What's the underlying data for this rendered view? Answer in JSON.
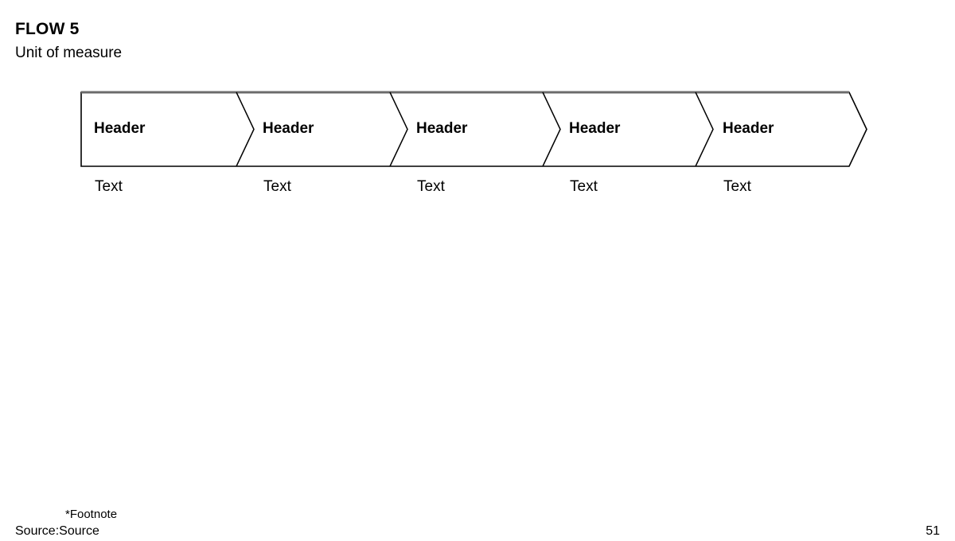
{
  "slide": {
    "title": "FLOW 5",
    "subtitle": "Unit of measure"
  },
  "flow": {
    "stages": [
      {
        "header": "Header",
        "text": "Text"
      },
      {
        "header": "Header",
        "text": "Text"
      },
      {
        "header": "Header",
        "text": "Text"
      },
      {
        "header": "Header",
        "text": "Text"
      },
      {
        "header": "Header",
        "text": "Text"
      }
    ]
  },
  "footer": {
    "footnote": "*Footnote",
    "source": "Source:Source",
    "page_number": "51"
  },
  "colors": {
    "top_border": "#6b6b6b",
    "outline": "#000000",
    "fill": "#ffffff",
    "text": "#000000"
  }
}
